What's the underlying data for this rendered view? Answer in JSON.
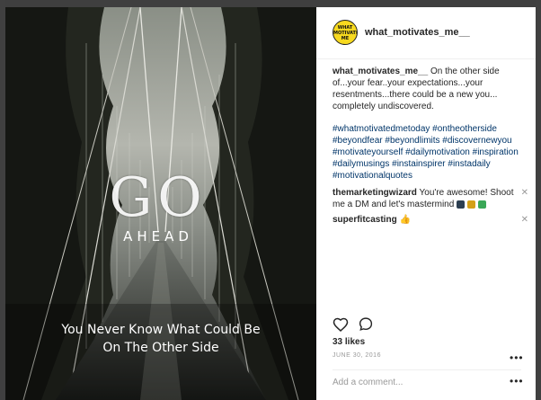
{
  "post": {
    "image_text": {
      "big_word": "GO",
      "sub_word": "AHEAD",
      "quote_line_1": "You Never Know What Could Be",
      "quote_line_2": "On The Other Side"
    },
    "avatar_text": "WHAT MOTIVATES ME",
    "username": "what_motivates_me__",
    "caption_username": "what_motivates_me__",
    "caption_text": "On the other side of...your fear..your expectations...your resentments...there could be a new you... completely undiscovered.",
    "hashtags": "#whatmotivatedmetoday #ontheotherside #beyondfear #beyondlimits #discovernewyou #motivateyourself #dailymotivation #inspiration #dailymusings #instainspirer #instadaily #motivationalquotes",
    "comments": [
      {
        "username": "themarketingwizard",
        "text": "You're awesome! Shoot me a DM and let's mastermind"
      },
      {
        "username": "superfitcasting",
        "text": "👍"
      }
    ],
    "close_glyph": "✕",
    "likes": "33 likes",
    "date": "JUNE 30, 2016",
    "more_glyph": "•••",
    "add_comment_placeholder": "Add a comment..."
  },
  "colors": {
    "hashtag": "#003569",
    "avatar": "#f7d91f",
    "backdrop": "#404040"
  },
  "icons": [
    "heart-icon",
    "comment-bubble-icon",
    "close-icon",
    "more-options-icon"
  ]
}
